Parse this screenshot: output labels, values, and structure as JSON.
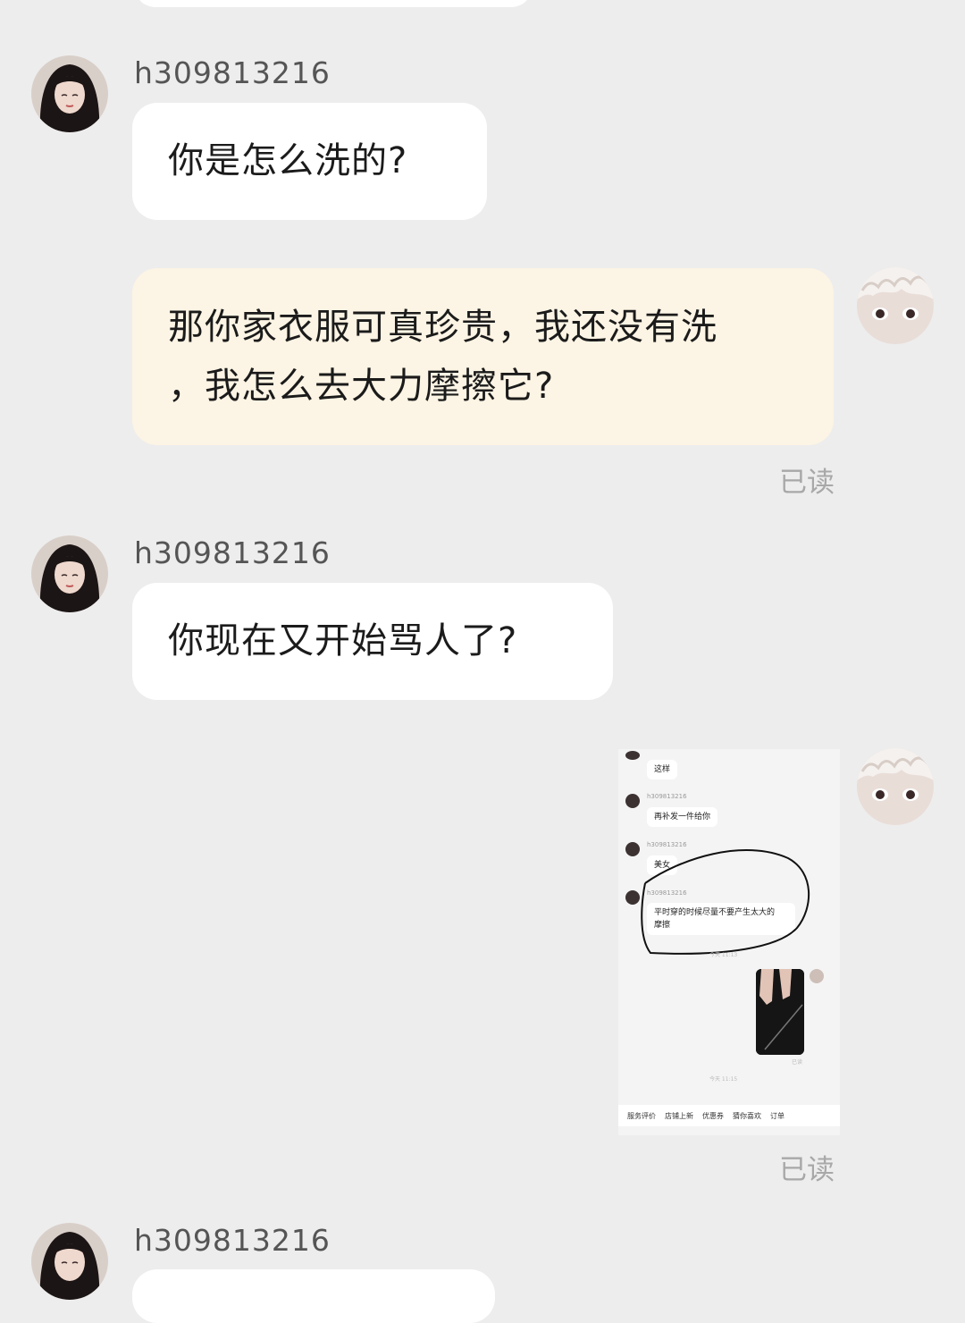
{
  "messages": [
    {
      "sender": "h309813216",
      "text": "你是怎么洗的?"
    },
    {
      "line1": "那你家衣服可真珍贵，我还没有洗",
      "line2": "，我怎么去大力摩擦它?",
      "status": "已读"
    },
    {
      "sender": "h309813216",
      "text": "你现在又开始骂人了?"
    },
    {
      "status": "已读"
    },
    {
      "sender": "h309813216"
    }
  ],
  "embedded_screenshot": {
    "messages": [
      {
        "text": "这样"
      },
      {
        "sender": "h309813216",
        "text": "再补发一件给你"
      },
      {
        "sender": "h309813216",
        "text": "美女"
      },
      {
        "sender": "h309813216",
        "line1": "平时穿的时候尽量不要产生太大的",
        "line2": "摩擦"
      }
    ],
    "time1": "今天 11:13",
    "read": "已读",
    "time2": "今天 11:15",
    "tabs": [
      "服务评价",
      "店铺上新",
      "优惠券",
      "猜你喜欢",
      "订单"
    ]
  }
}
